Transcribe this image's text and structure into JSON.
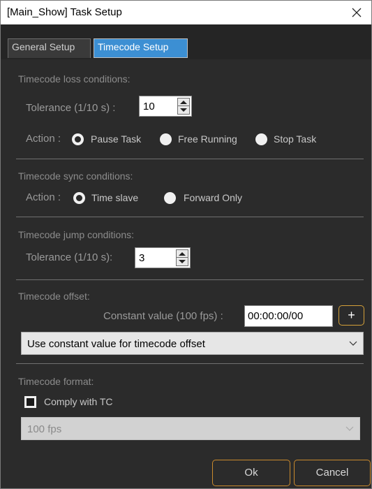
{
  "window": {
    "title": "[Main_Show] Task Setup"
  },
  "tabs": [
    {
      "label": "General Setup",
      "active": false
    },
    {
      "label": "Timecode Setup",
      "active": true
    }
  ],
  "loss": {
    "title": "Timecode loss conditions:",
    "tolerance_label": "Tolerance (1/10 s)  :",
    "tolerance_value": "10",
    "action_label": "Action :",
    "options": [
      "Pause Task",
      "Free Running",
      "Stop Task"
    ],
    "selected": "Pause Task"
  },
  "sync": {
    "title": "Timecode sync conditions:",
    "action_label": "Action :",
    "options": [
      "Time slave",
      "Forward Only"
    ],
    "selected": "Time slave"
  },
  "jump": {
    "title": "Timecode jump conditions:",
    "tolerance_label": "Tolerance (1/10 s):",
    "tolerance_value": "3"
  },
  "offset": {
    "title": "Timecode offset:",
    "constant_label": "Constant value (100 fps) :",
    "constant_value": "00:00:00/00",
    "plus_label": "+",
    "mode_selected": "Use constant value for timecode offset"
  },
  "format": {
    "title": "Timecode format:",
    "comply_label": "Comply with TC",
    "comply_checked": true,
    "fps_selected": "100 fps",
    "fps_enabled": false
  },
  "buttons": {
    "ok": "Ok",
    "cancel": "Cancel"
  },
  "colors": {
    "background": "#2b2b2b",
    "tab_active": "#3c8fd3",
    "button_border": "#c98a2d"
  }
}
